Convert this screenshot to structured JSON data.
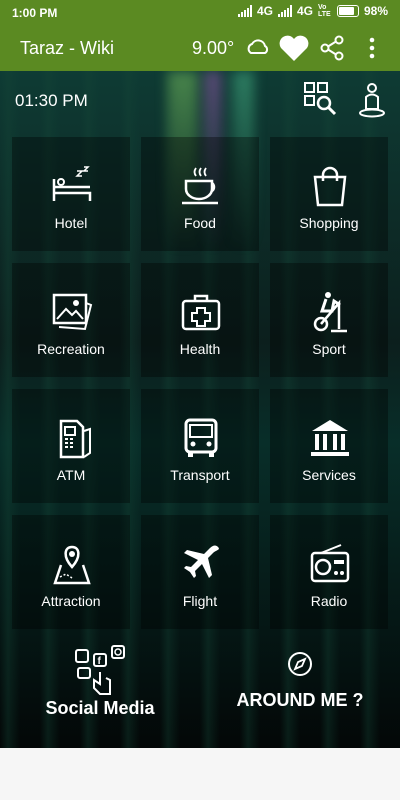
{
  "status_bar": {
    "time": "1:00 PM",
    "network_1": "4G",
    "network_2": "4G",
    "volte": "Vo LTE",
    "battery": "98%"
  },
  "app_bar": {
    "title": "Taraz - Wiki",
    "temperature": "9.00°"
  },
  "main": {
    "clock": "01:30 PM",
    "tiles": [
      {
        "label": "Hotel",
        "icon": "bed-icon"
      },
      {
        "label": "Food",
        "icon": "coffee-cup-icon"
      },
      {
        "label": "Shopping",
        "icon": "shopping-bag-icon"
      },
      {
        "label": "Recreation",
        "icon": "picture-icon"
      },
      {
        "label": "Health",
        "icon": "first-aid-kit-icon"
      },
      {
        "label": "Sport",
        "icon": "exercise-bike-icon"
      },
      {
        "label": "ATM",
        "icon": "atm-machine-icon"
      },
      {
        "label": "Transport",
        "icon": "bus-icon"
      },
      {
        "label": "Services",
        "icon": "bank-building-icon"
      },
      {
        "label": "Attraction",
        "icon": "map-pin-icon"
      },
      {
        "label": "Flight",
        "icon": "airplane-icon"
      },
      {
        "label": "Radio",
        "icon": "radio-icon"
      }
    ],
    "social_media_label": "Social Media",
    "around_me_label": "AROUND ME ?"
  },
  "colors": {
    "app_bar": "#5b8a22",
    "text": "#ffffff"
  }
}
